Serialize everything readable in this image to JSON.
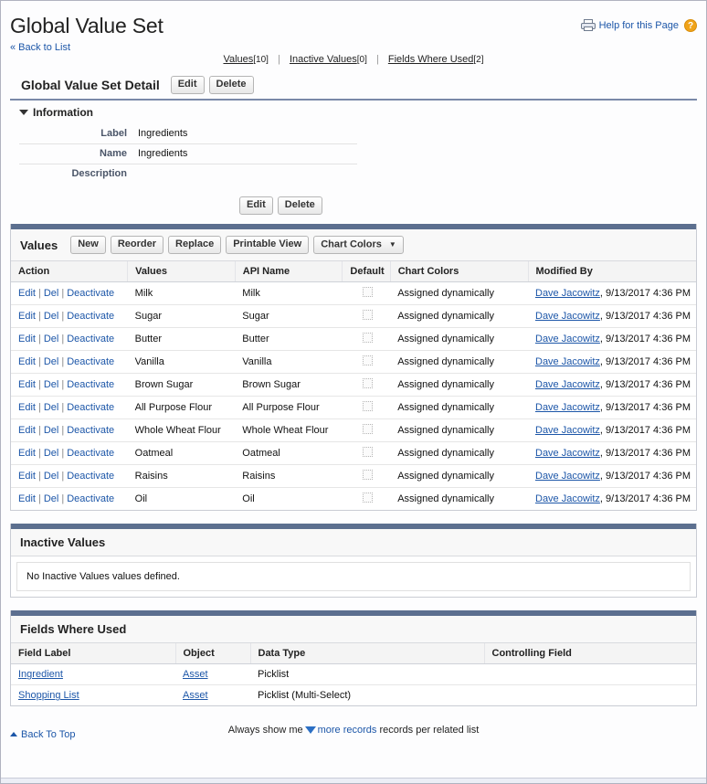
{
  "header": {
    "title": "Global Value Set",
    "back_to_list": "« Back to List",
    "printer_icon": "printer-icon",
    "help_link": "Help for this Page",
    "help_badge": "?"
  },
  "related_nav": [
    {
      "label": "Values",
      "count": "[10]"
    },
    {
      "label": "Inactive Values",
      "count": "[0]"
    },
    {
      "label": "Fields Where Used",
      "count": "[2]"
    }
  ],
  "detail": {
    "title": "Global Value Set Detail",
    "edit_label": "Edit",
    "delete_label": "Delete",
    "section_title": "Information",
    "fields": [
      {
        "label": "Label",
        "value": "Ingredients"
      },
      {
        "label": "Name",
        "value": "Ingredients"
      },
      {
        "label": "Description",
        "value": ""
      }
    ],
    "bottom_edit_label": "Edit",
    "bottom_delete_label": "Delete"
  },
  "values_panel": {
    "title": "Values",
    "buttons": [
      {
        "label": "New"
      },
      {
        "label": "Reorder"
      },
      {
        "label": "Replace"
      },
      {
        "label": "Printable View"
      }
    ],
    "chart_colors_button": "Chart Colors",
    "chart_colors_caret": "▼",
    "columns": [
      "Action",
      "Values",
      "API Name",
      "Default",
      "Chart Colors",
      "Modified By"
    ],
    "action_edit": "Edit",
    "action_del": "Del",
    "action_deactivate": "Deactivate",
    "rows": [
      {
        "value": "Milk",
        "api_name": "Milk",
        "default": false,
        "chart_color": "Assigned dynamically",
        "modified_by_user": "Dave Jacowitz",
        "modified_date": ", 9/13/2017 4:36 PM"
      },
      {
        "value": "Sugar",
        "api_name": "Sugar",
        "default": false,
        "chart_color": "Assigned dynamically",
        "modified_by_user": "Dave Jacowitz",
        "modified_date": ", 9/13/2017 4:36 PM"
      },
      {
        "value": "Butter",
        "api_name": "Butter",
        "default": false,
        "chart_color": "Assigned dynamically",
        "modified_by_user": "Dave Jacowitz",
        "modified_date": ", 9/13/2017 4:36 PM"
      },
      {
        "value": "Vanilla",
        "api_name": "Vanilla",
        "default": false,
        "chart_color": "Assigned dynamically",
        "modified_by_user": "Dave Jacowitz",
        "modified_date": ", 9/13/2017 4:36 PM"
      },
      {
        "value": "Brown Sugar",
        "api_name": "Brown Sugar",
        "default": false,
        "chart_color": "Assigned dynamically",
        "modified_by_user": "Dave Jacowitz",
        "modified_date": ", 9/13/2017 4:36 PM"
      },
      {
        "value": "All Purpose Flour",
        "api_name": "All Purpose Flour",
        "default": false,
        "chart_color": "Assigned dynamically",
        "modified_by_user": "Dave Jacowitz",
        "modified_date": ", 9/13/2017 4:36 PM"
      },
      {
        "value": "Whole Wheat Flour",
        "api_name": "Whole Wheat Flour",
        "default": false,
        "chart_color": "Assigned dynamically",
        "modified_by_user": "Dave Jacowitz",
        "modified_date": ", 9/13/2017 4:36 PM"
      },
      {
        "value": "Oatmeal",
        "api_name": "Oatmeal",
        "default": false,
        "chart_color": "Assigned dynamically",
        "modified_by_user": "Dave Jacowitz",
        "modified_date": ", 9/13/2017 4:36 PM"
      },
      {
        "value": "Raisins",
        "api_name": "Raisins",
        "default": false,
        "chart_color": "Assigned dynamically",
        "modified_by_user": "Dave Jacowitz",
        "modified_date": ", 9/13/2017 4:36 PM"
      },
      {
        "value": "Oil",
        "api_name": "Oil",
        "default": false,
        "chart_color": "Assigned dynamically",
        "modified_by_user": "Dave Jacowitz",
        "modified_date": ", 9/13/2017 4:36 PM"
      }
    ]
  },
  "inactive_panel": {
    "title": "Inactive Values",
    "empty_message": "No Inactive Values values defined."
  },
  "fields_panel": {
    "title": "Fields Where Used",
    "columns": [
      "Field Label",
      "Object",
      "Data Type",
      "Controlling Field"
    ],
    "rows": [
      {
        "field_label": "Ingredient",
        "object": "Asset",
        "data_type": "Picklist",
        "controlling_field": ""
      },
      {
        "field_label": "Shopping List",
        "object": "Asset",
        "data_type": "Picklist (Multi-Select)",
        "controlling_field": ""
      }
    ]
  },
  "footer": {
    "back_to_top": "Back To Top",
    "show_me_prefix": "Always show me",
    "show_me_link": "more records",
    "show_me_suffix": "records per related list"
  },
  "colors": {
    "link": "#1c56a8",
    "panel_bar": "#5c6f8f",
    "help_badge": "#f0a319"
  }
}
